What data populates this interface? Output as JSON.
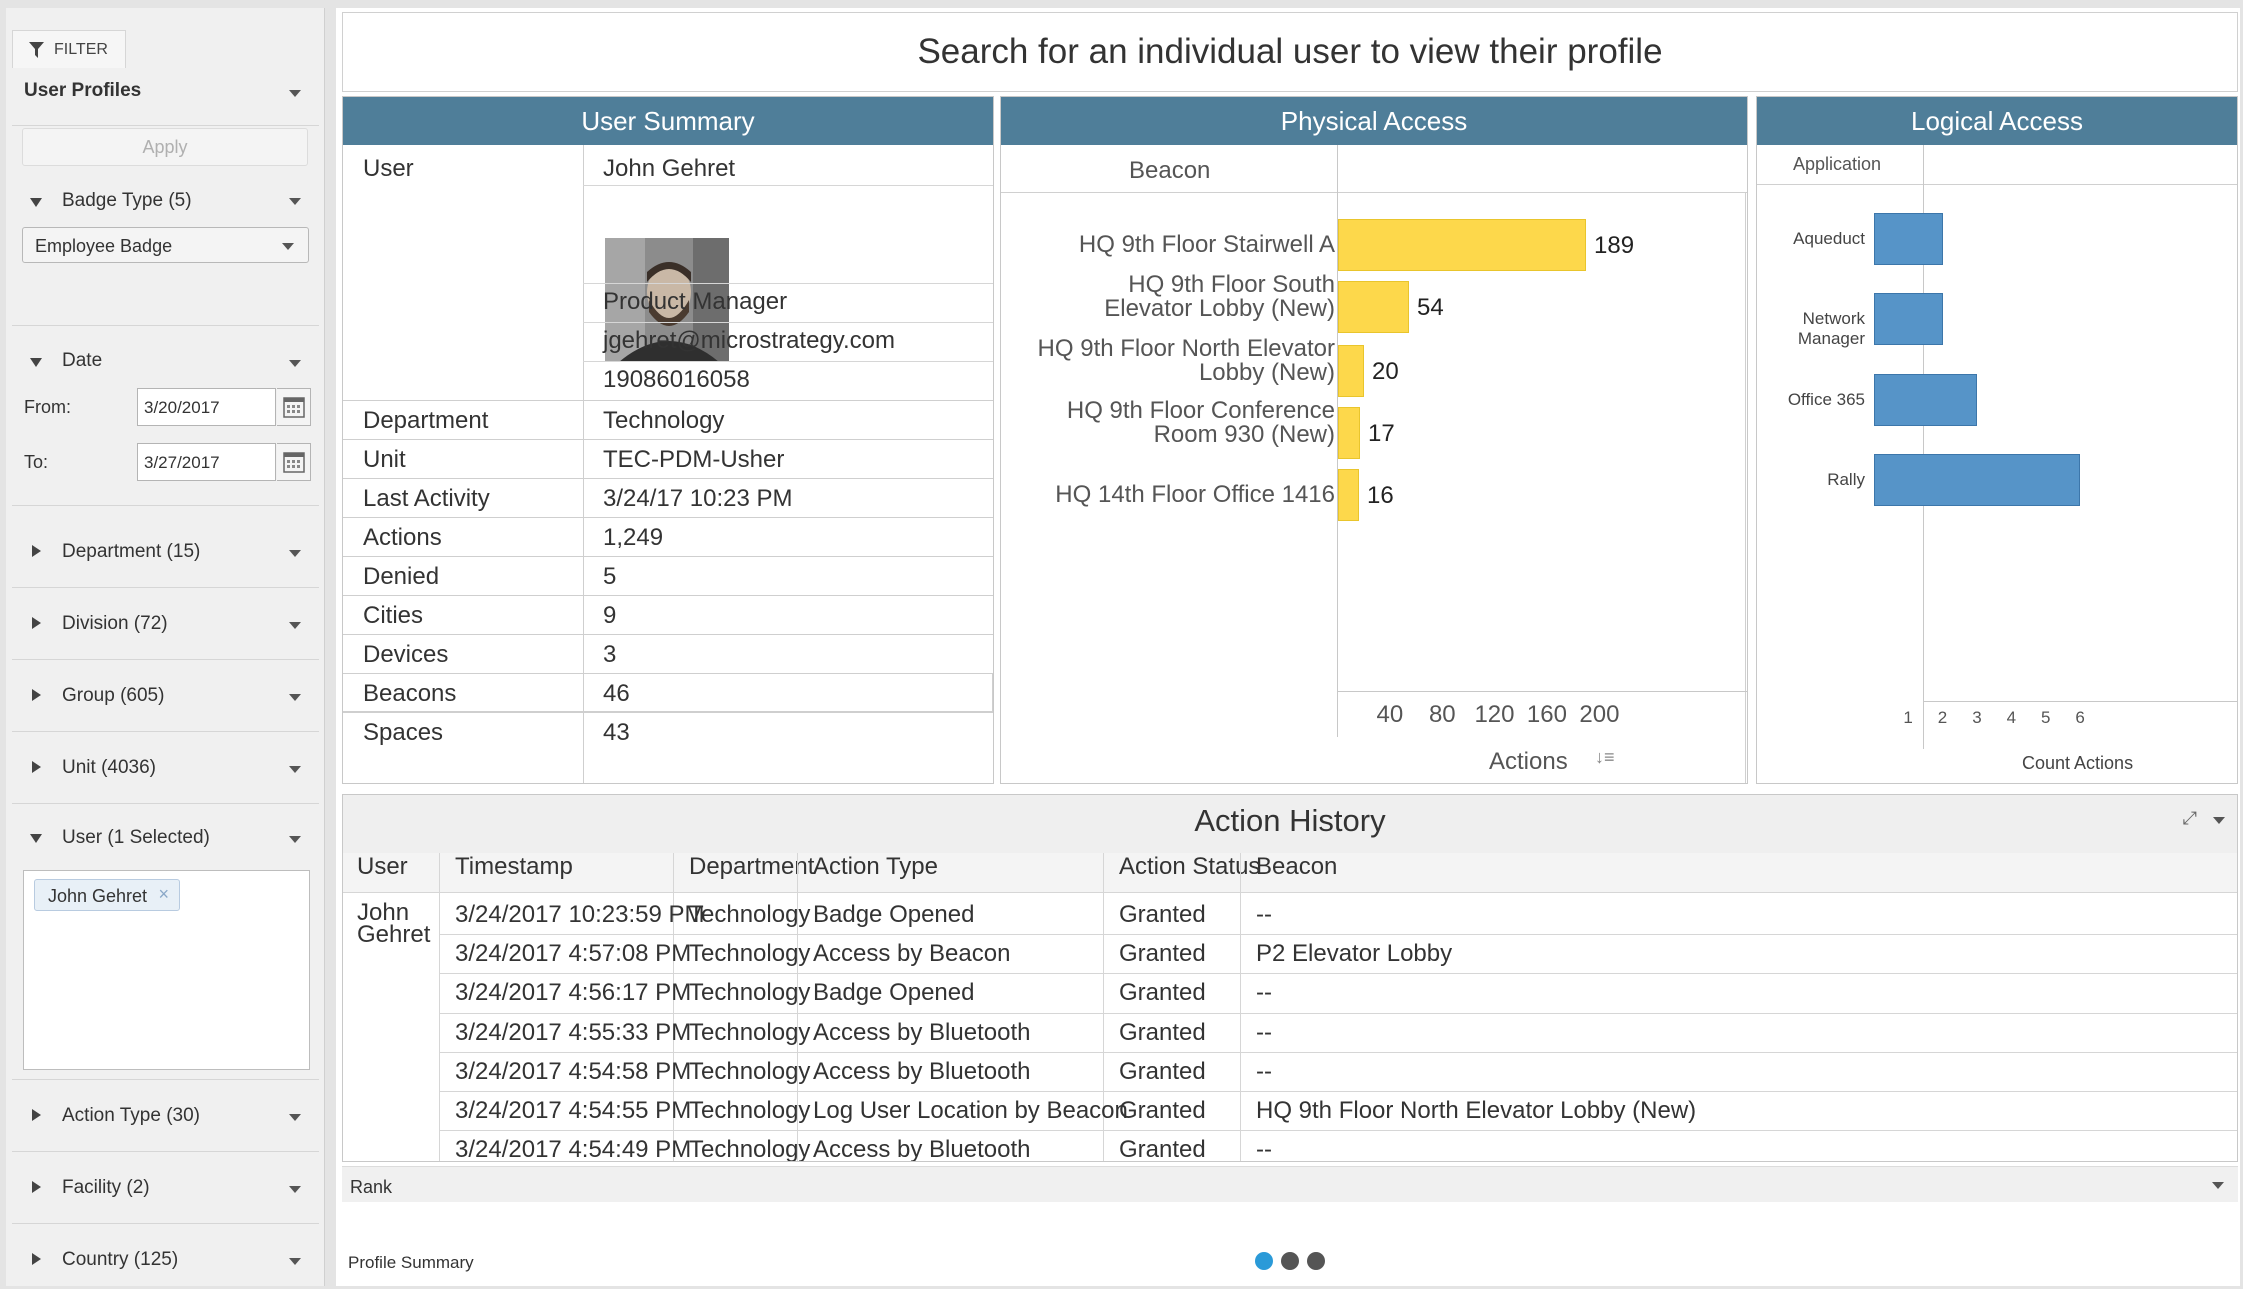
{
  "filter_panel": {
    "tab_label": "FILTER",
    "profile_select": "User Profiles",
    "apply_label": "Apply",
    "badge_type": {
      "title": "Badge Type (5)",
      "selected": "Employee Badge"
    },
    "date": {
      "title": "Date",
      "from_label": "From:",
      "from_value": "3/20/2017",
      "to_label": "To:",
      "to_value": "3/27/2017"
    },
    "sections": [
      {
        "title": "Department (15)"
      },
      {
        "title": "Division (72)"
      },
      {
        "title": "Group (605)"
      },
      {
        "title": "Unit (4036)"
      }
    ],
    "user": {
      "title": "User (1 Selected)",
      "tag": "John Gehret",
      "tag_remove": "×"
    },
    "sections_bottom": [
      {
        "title": "Action Type (30)"
      },
      {
        "title": "Facility (2)"
      },
      {
        "title": "Country (125)"
      }
    ]
  },
  "header": {
    "title": "Search for an individual user to view their profile"
  },
  "user_summary": {
    "title": "User Summary",
    "user_label": "User",
    "user_name": "John Gehret",
    "job_title": "Product Manager",
    "email": "jgehret@microstrategy.com",
    "phone": "19086016058",
    "rows": [
      {
        "k": "Department",
        "v": "Technology"
      },
      {
        "k": "Unit",
        "v": "TEC-PDM-Usher"
      },
      {
        "k": "Last Activity",
        "v": "3/24/17 10:23 PM"
      },
      {
        "k": "Actions",
        "v": "1,249"
      },
      {
        "k": "Denied",
        "v": "5"
      },
      {
        "k": "Cities",
        "v": "9"
      },
      {
        "k": "Devices",
        "v": "3"
      },
      {
        "k": "Beacons",
        "v": "46"
      },
      {
        "k": "Spaces",
        "v": "43"
      }
    ]
  },
  "physical_access": {
    "title": "Physical Access",
    "column_header": "Beacon",
    "axis_label": "Actions",
    "ticks": [
      "40",
      "80",
      "120",
      "160",
      "200"
    ]
  },
  "logical_access": {
    "title": "Logical Access",
    "column_header": "Application",
    "axis_label": "Count Actions",
    "ticks": [
      "1",
      "2",
      "3",
      "4",
      "5",
      "6"
    ]
  },
  "chart_data": [
    {
      "type": "bar",
      "orientation": "horizontal",
      "title": "Physical Access",
      "xlabel": "Actions",
      "ylabel": "Beacon",
      "xlim": [
        0,
        215
      ],
      "categories": [
        "HQ 9th Floor Stairwell A",
        "HQ 9th Floor South Elevator Lobby (New)",
        "HQ 9th Floor North Elevator Lobby (New)",
        "HQ 9th Floor Conference Room 930 (New)",
        "HQ 14th Floor Office 1416"
      ],
      "category_lines": [
        [
          "HQ 9th Floor Stairwell A"
        ],
        [
          "HQ 9th Floor South",
          "Elevator Lobby (New)"
        ],
        [
          "HQ 9th Floor North Elevator",
          "Lobby (New)"
        ],
        [
          "HQ 9th Floor Conference",
          "Room 930 (New)"
        ],
        [
          "HQ 14th Floor Office 1416"
        ]
      ],
      "values": [
        189,
        54,
        20,
        17,
        16
      ],
      "color": "#fdd84b"
    },
    {
      "type": "bar",
      "orientation": "horizontal",
      "title": "Logical Access",
      "xlabel": "Count Actions",
      "ylabel": "Application",
      "xlim": [
        0,
        6
      ],
      "categories": [
        "Aqueduct",
        "Network Manager",
        "Office 365",
        "Rally"
      ],
      "values": [
        2,
        2,
        3,
        6
      ],
      "color": "#5694c8"
    }
  ],
  "action_history": {
    "title": "Action History",
    "columns": [
      "User",
      "Timestamp",
      "Department",
      "Action Type",
      "Action Status",
      "Beacon"
    ],
    "user_first": "John",
    "user_last": "Gehret",
    "rows": [
      {
        "timestamp": "3/24/2017 10:23:59 PM",
        "department": "Technology",
        "action_type": "Badge Opened",
        "status": "Granted",
        "beacon": "--"
      },
      {
        "timestamp": "3/24/2017 4:57:08 PM",
        "department": "Technology",
        "action_type": "Access by Beacon",
        "status": "Granted",
        "beacon": "P2 Elevator Lobby"
      },
      {
        "timestamp": "3/24/2017 4:56:17 PM",
        "department": "Technology",
        "action_type": "Badge Opened",
        "status": "Granted",
        "beacon": "--"
      },
      {
        "timestamp": "3/24/2017 4:55:33 PM",
        "department": "Technology",
        "action_type": "Access by Bluetooth",
        "status": "Granted",
        "beacon": "--"
      },
      {
        "timestamp": "3/24/2017 4:54:58 PM",
        "department": "Technology",
        "action_type": "Access by Bluetooth",
        "status": "Granted",
        "beacon": "--"
      },
      {
        "timestamp": "3/24/2017 4:54:55 PM",
        "department": "Technology",
        "action_type": "Log User Location by Beacon",
        "status": "Granted",
        "beacon": "HQ 9th Floor North Elevator Lobby (New)"
      },
      {
        "timestamp": "3/24/2017 4:54:49 PM",
        "department": "Technology",
        "action_type": "Access by Bluetooth",
        "status": "Granted",
        "beacon": "--"
      }
    ]
  },
  "rank_bar": {
    "label": "Rank"
  },
  "footer": {
    "label": "Profile Summary",
    "pages": 3,
    "active_page": 1
  },
  "colors": {
    "header_bar": "#4f7e99",
    "physical_bar": "#fdd84b",
    "logical_bar": "#5694c8",
    "dot_active": "#2a9ad8",
    "dot_inactive": "#555555"
  }
}
